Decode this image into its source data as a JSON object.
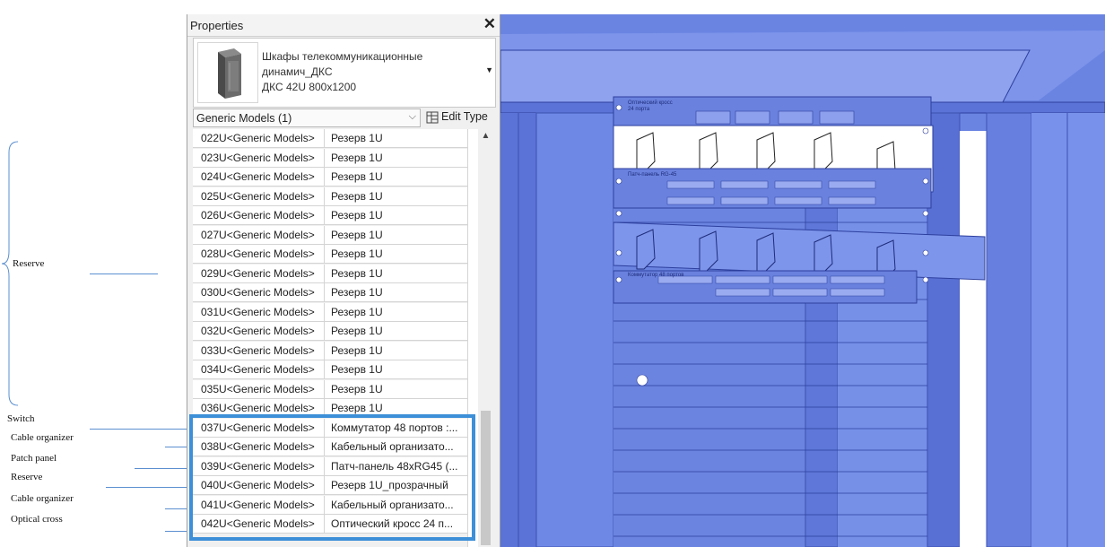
{
  "annotations": {
    "reserve_top": "Reserve",
    "switch": "Switch",
    "cable_organizer_1": "Cable organizer",
    "patch_panel": "Patch panel",
    "reserve_bottom": "Reserve",
    "cable_organizer_2": "Cable organizer",
    "optical_cross": "Optical cross"
  },
  "properties": {
    "title": "Properties",
    "close_glyph": "✕",
    "type": {
      "line1": "Шкафы телекоммуникационные",
      "line2": "динамич_ДКС",
      "line3": "ДКС 42U 800x1200",
      "icon": "server-rack-icon"
    },
    "selector": {
      "value": "Generic Models (1)"
    },
    "edit_type_label": "Edit Type",
    "rows": [
      {
        "name": "022U<Generic Models>",
        "value": "Резерв 1U"
      },
      {
        "name": "023U<Generic Models>",
        "value": "Резерв 1U"
      },
      {
        "name": "024U<Generic Models>",
        "value": "Резерв 1U"
      },
      {
        "name": "025U<Generic Models>",
        "value": "Резерв 1U"
      },
      {
        "name": "026U<Generic Models>",
        "value": "Резерв 1U"
      },
      {
        "name": "027U<Generic Models>",
        "value": "Резерв 1U"
      },
      {
        "name": "028U<Generic Models>",
        "value": "Резерв 1U"
      },
      {
        "name": "029U<Generic Models>",
        "value": "Резерв 1U"
      },
      {
        "name": "030U<Generic Models>",
        "value": "Резерв 1U"
      },
      {
        "name": "031U<Generic Models>",
        "value": "Резерв 1U"
      },
      {
        "name": "032U<Generic Models>",
        "value": "Резерв 1U"
      },
      {
        "name": "033U<Generic Models>",
        "value": "Резерв 1U"
      },
      {
        "name": "034U<Generic Models>",
        "value": "Резерв 1U"
      },
      {
        "name": "035U<Generic Models>",
        "value": "Резерв 1U"
      },
      {
        "name": "036U<Generic Models>",
        "value": "Резерв 1U"
      },
      {
        "name": "037U<Generic Models>",
        "value": "Коммутатор 48 портов :..."
      },
      {
        "name": "038U<Generic Models>",
        "value": "Кабельный организато..."
      },
      {
        "name": "039U<Generic Models>",
        "value": "Патч-панель 48xRG45 (..."
      },
      {
        "name": "040U<Generic Models>",
        "value": "Резерв 1U_прозрачный"
      },
      {
        "name": "041U<Generic Models>",
        "value": "Кабельный организато..."
      },
      {
        "name": "042U<Generic Models>",
        "value": "Оптический кросс 24 п..."
      }
    ]
  },
  "viewport": {
    "labels": {
      "optical_cross_top": "Оптический кросс",
      "optical_cross_sub": "24 порта",
      "patch_panel": "Патч-панель RG-45",
      "switch": "Коммутатор 48 портов"
    },
    "colors": {
      "glass": "#6a84e2",
      "frame": "#5068c8",
      "edge": "#2d3f9e",
      "highlight_box": "#3d8fd8"
    }
  }
}
